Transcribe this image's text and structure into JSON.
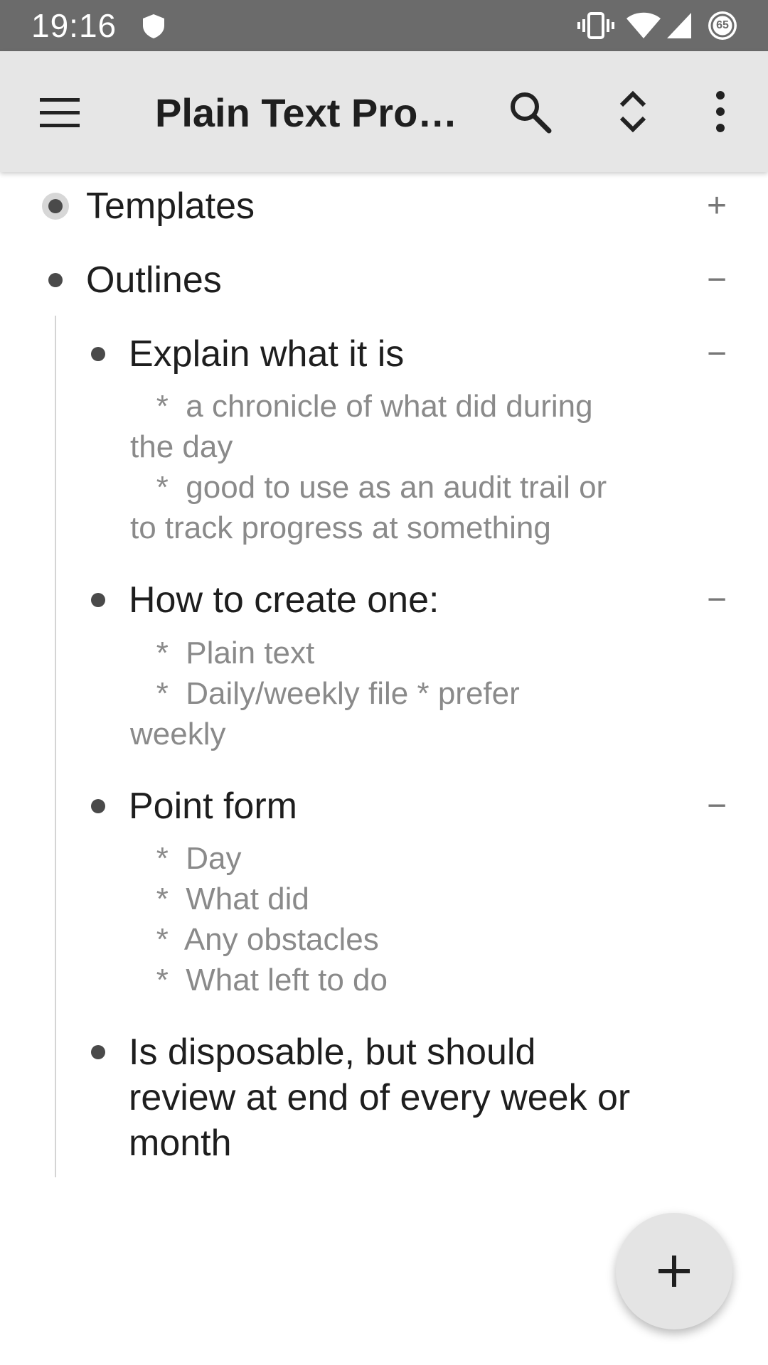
{
  "status_bar": {
    "time": "19:16",
    "battery_level": "65",
    "icons": [
      "shield-icon",
      "vibrate-icon",
      "wifi-icon",
      "signal-icon",
      "battery-icon"
    ]
  },
  "app_bar": {
    "title": "Plain Text Projects",
    "icons": [
      "menu-icon",
      "search-icon",
      "expand-collapse-icon",
      "more-vert-icon"
    ]
  },
  "outline": {
    "nodes": [
      {
        "title": "Templates",
        "action": "+"
      },
      {
        "title": "Outlines",
        "action": "−"
      }
    ],
    "children": [
      {
        "title": "Explain what it is",
        "action": "−",
        "note": "   *  a chronicle of what did during\nthe day\n   *  good to use as an audit trail or\nto track progress at something"
      },
      {
        "title": "How to create one:",
        "action": "−",
        "note": "   *  Plain text\n   *  Daily/weekly file * prefer\nweekly"
      },
      {
        "title": "Point form",
        "action": "−",
        "note": "   *  Day\n   *  What did\n   *  Any obstacles\n   *  What left to do"
      },
      {
        "title": "Is disposable, but should\nreview at end of every week or\nmonth",
        "action": "",
        "note": ""
      }
    ]
  },
  "fab": {
    "label": "+"
  },
  "colors": {
    "status_bar": "#6b6b6b",
    "app_bar": "#e6e6e6",
    "text_primary": "#1e1e1e",
    "text_secondary": "#8a8a8a"
  }
}
